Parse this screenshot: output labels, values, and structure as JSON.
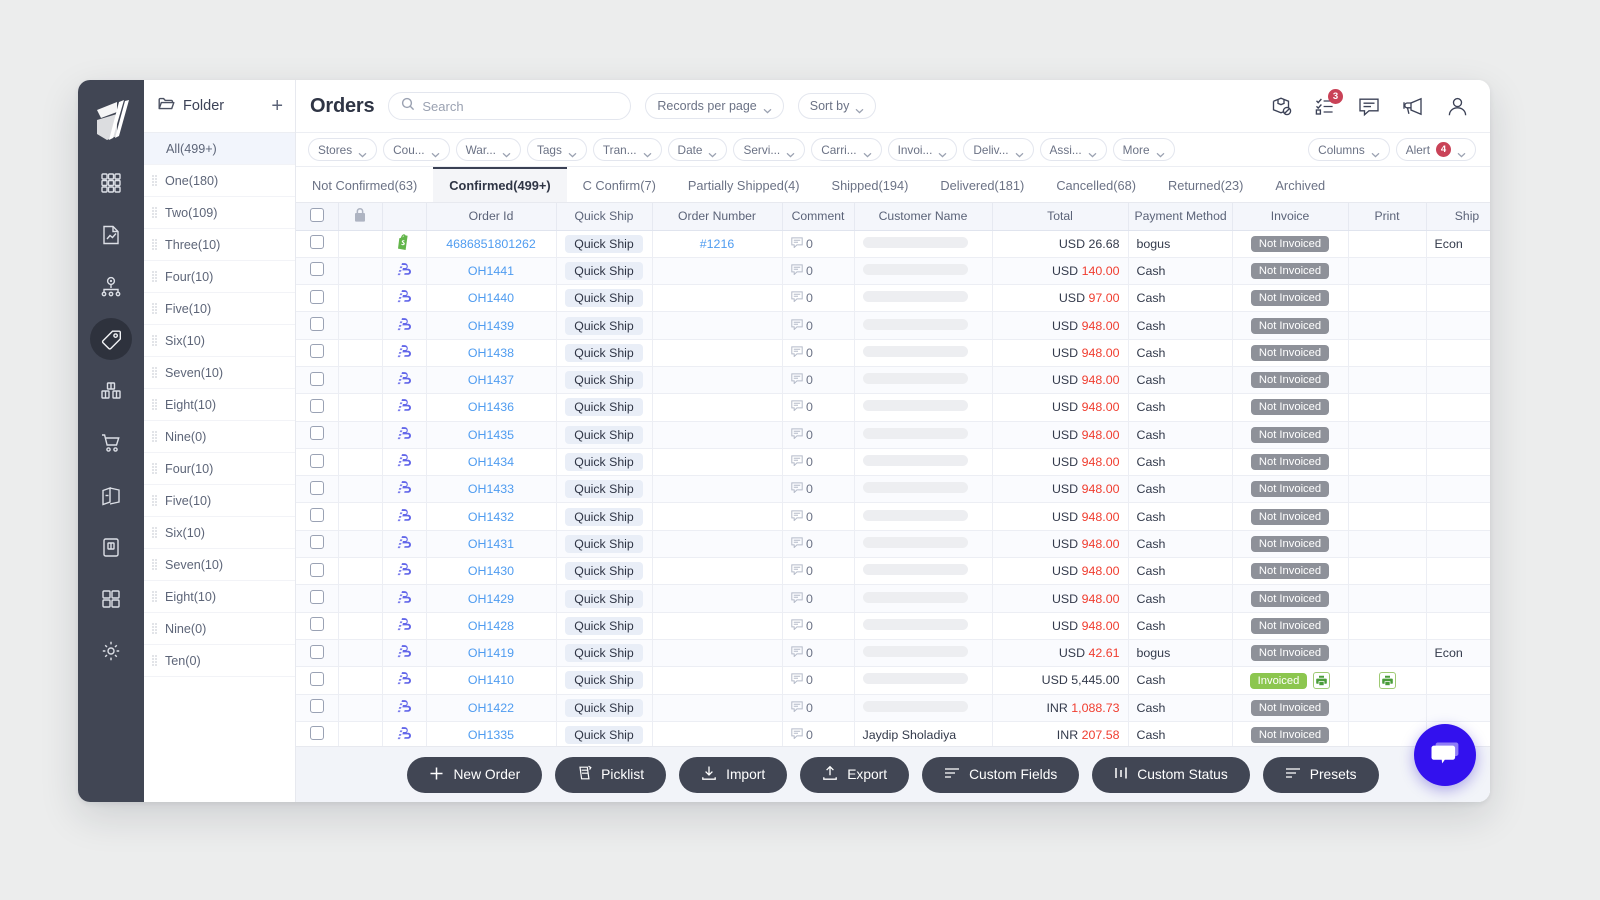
{
  "brand": {
    "accent": "#3311ee",
    "rail_bg": "#414654",
    "link": "#4f9cf0",
    "danger": "#f03d2f",
    "badge": "#c94257",
    "invoiced_green": "#8cc64f"
  },
  "header": {
    "title": "Orders",
    "search_placeholder": "Search",
    "records_per_page": "Records per page",
    "sort_by": "Sort by",
    "icons": [
      {
        "name": "package-blocked-icon",
        "badge": ""
      },
      {
        "name": "checklist-icon",
        "badge": "3"
      },
      {
        "name": "comment-icon",
        "badge": ""
      },
      {
        "name": "megaphone-icon",
        "badge": ""
      },
      {
        "name": "user-icon",
        "badge": ""
      }
    ]
  },
  "sidebar_rail": {
    "items": [
      {
        "name": "dashboard-grid-icon",
        "active": false
      },
      {
        "name": "report-document-icon",
        "active": false
      },
      {
        "name": "network-hierarchy-icon",
        "active": false
      },
      {
        "name": "tag-icon",
        "active": true
      },
      {
        "name": "inventory-boxes-icon",
        "active": false
      },
      {
        "name": "shopping-cart-icon",
        "active": false
      },
      {
        "name": "open-box-icon",
        "active": false
      },
      {
        "name": "clipboard-box-icon",
        "active": false
      },
      {
        "name": "apps-squares-icon",
        "active": false
      },
      {
        "name": "gear-icon",
        "active": false
      }
    ]
  },
  "folders": {
    "header_label": "Folder",
    "add_label": "+",
    "items": [
      {
        "label": "All(499+)",
        "selected": true
      },
      {
        "label": "One(180)",
        "selected": false
      },
      {
        "label": "Two(109)",
        "selected": false
      },
      {
        "label": "Three(10)",
        "selected": false
      },
      {
        "label": "Four(10)",
        "selected": false
      },
      {
        "label": "Five(10)",
        "selected": false
      },
      {
        "label": "Six(10)",
        "selected": false
      },
      {
        "label": "Seven(10)",
        "selected": false
      },
      {
        "label": "Eight(10)",
        "selected": false
      },
      {
        "label": "Nine(0)",
        "selected": false
      },
      {
        "label": "Four(10)",
        "selected": false
      },
      {
        "label": "Five(10)",
        "selected": false
      },
      {
        "label": "Six(10)",
        "selected": false
      },
      {
        "label": "Seven(10)",
        "selected": false
      },
      {
        "label": "Eight(10)",
        "selected": false
      },
      {
        "label": "Nine(0)",
        "selected": false
      },
      {
        "label": "Ten(0)",
        "selected": false
      }
    ]
  },
  "filters": {
    "chips": [
      "Stores",
      "Cou...",
      "War...",
      "Tags",
      "Tran...",
      "Date",
      "Servi...",
      "Carri...",
      "Invoi...",
      "Deliv...",
      "Assi...",
      "More"
    ],
    "columns_label": "Columns",
    "alert_label": "Alert",
    "alert_count": "4"
  },
  "tabs": [
    {
      "label": "Not Confirmed(63)",
      "active": false
    },
    {
      "label": "Confirmed(499+)",
      "active": true
    },
    {
      "label": "C Confirm(7)",
      "active": false
    },
    {
      "label": "Partially Shipped(4)",
      "active": false
    },
    {
      "label": "Shipped(194)",
      "active": false
    },
    {
      "label": "Delivered(181)",
      "active": false
    },
    {
      "label": "Cancelled(68)",
      "active": false
    },
    {
      "label": "Returned(23)",
      "active": false
    },
    {
      "label": "Archived",
      "active": false
    }
  ],
  "table": {
    "columns": [
      "",
      "lock-icon",
      "",
      "Order Id",
      "Quick Ship",
      "Order Number",
      "Comment",
      "Customer Name",
      "Total",
      "Payment Method",
      "Invoice",
      "Print",
      "Ship"
    ],
    "quick_ship_label": "Quick Ship",
    "not_invoiced_label": "Not Invoiced",
    "invoiced_label": "Invoiced",
    "rows": [
      {
        "channel": "shopify",
        "order_id": "4686851801262",
        "order_number": "#1216",
        "comments": "0",
        "currency": "USD",
        "amount": "26.68",
        "amount_red": false,
        "payment": "bogus",
        "invoice": "Not Invoiced",
        "invoiced": false,
        "print": false,
        "ship": "Econ"
      },
      {
        "channel": "generic",
        "order_id": "OH1441",
        "order_number": "",
        "comments": "0",
        "currency": "USD",
        "amount": "140.00",
        "amount_red": true,
        "payment": "Cash",
        "invoice": "Not Invoiced",
        "invoiced": false,
        "print": false,
        "ship": ""
      },
      {
        "channel": "generic",
        "order_id": "OH1440",
        "order_number": "",
        "comments": "0",
        "currency": "USD",
        "amount": "97.00",
        "amount_red": true,
        "payment": "Cash",
        "invoice": "Not Invoiced",
        "invoiced": false,
        "print": false,
        "ship": ""
      },
      {
        "channel": "generic",
        "order_id": "OH1439",
        "order_number": "",
        "comments": "0",
        "currency": "USD",
        "amount": "948.00",
        "amount_red": true,
        "payment": "Cash",
        "invoice": "Not Invoiced",
        "invoiced": false,
        "print": false,
        "ship": ""
      },
      {
        "channel": "generic",
        "order_id": "OH1438",
        "order_number": "",
        "comments": "0",
        "currency": "USD",
        "amount": "948.00",
        "amount_red": true,
        "payment": "Cash",
        "invoice": "Not Invoiced",
        "invoiced": false,
        "print": false,
        "ship": ""
      },
      {
        "channel": "generic",
        "order_id": "OH1437",
        "order_number": "",
        "comments": "0",
        "currency": "USD",
        "amount": "948.00",
        "amount_red": true,
        "payment": "Cash",
        "invoice": "Not Invoiced",
        "invoiced": false,
        "print": false,
        "ship": ""
      },
      {
        "channel": "generic",
        "order_id": "OH1436",
        "order_number": "",
        "comments": "0",
        "currency": "USD",
        "amount": "948.00",
        "amount_red": true,
        "payment": "Cash",
        "invoice": "Not Invoiced",
        "invoiced": false,
        "print": false,
        "ship": ""
      },
      {
        "channel": "generic",
        "order_id": "OH1435",
        "order_number": "",
        "comments": "0",
        "currency": "USD",
        "amount": "948.00",
        "amount_red": true,
        "payment": "Cash",
        "invoice": "Not Invoiced",
        "invoiced": false,
        "print": false,
        "ship": ""
      },
      {
        "channel": "generic",
        "order_id": "OH1434",
        "order_number": "",
        "comments": "0",
        "currency": "USD",
        "amount": "948.00",
        "amount_red": true,
        "payment": "Cash",
        "invoice": "Not Invoiced",
        "invoiced": false,
        "print": false,
        "ship": ""
      },
      {
        "channel": "generic",
        "order_id": "OH1433",
        "order_number": "",
        "comments": "0",
        "currency": "USD",
        "amount": "948.00",
        "amount_red": true,
        "payment": "Cash",
        "invoice": "Not Invoiced",
        "invoiced": false,
        "print": false,
        "ship": ""
      },
      {
        "channel": "generic",
        "order_id": "OH1432",
        "order_number": "",
        "comments": "0",
        "currency": "USD",
        "amount": "948.00",
        "amount_red": true,
        "payment": "Cash",
        "invoice": "Not Invoiced",
        "invoiced": false,
        "print": false,
        "ship": ""
      },
      {
        "channel": "generic",
        "order_id": "OH1431",
        "order_number": "",
        "comments": "0",
        "currency": "USD",
        "amount": "948.00",
        "amount_red": true,
        "payment": "Cash",
        "invoice": "Not Invoiced",
        "invoiced": false,
        "print": false,
        "ship": ""
      },
      {
        "channel": "generic",
        "order_id": "OH1430",
        "order_number": "",
        "comments": "0",
        "currency": "USD",
        "amount": "948.00",
        "amount_red": true,
        "payment": "Cash",
        "invoice": "Not Invoiced",
        "invoiced": false,
        "print": false,
        "ship": ""
      },
      {
        "channel": "generic",
        "order_id": "OH1429",
        "order_number": "",
        "comments": "0",
        "currency": "USD",
        "amount": "948.00",
        "amount_red": true,
        "payment": "Cash",
        "invoice": "Not Invoiced",
        "invoiced": false,
        "print": false,
        "ship": ""
      },
      {
        "channel": "generic",
        "order_id": "OH1428",
        "order_number": "",
        "comments": "0",
        "currency": "USD",
        "amount": "948.00",
        "amount_red": true,
        "payment": "Cash",
        "invoice": "Not Invoiced",
        "invoiced": false,
        "print": false,
        "ship": ""
      },
      {
        "channel": "generic",
        "order_id": "OH1419",
        "order_number": "",
        "comments": "0",
        "currency": "USD",
        "amount": "42.61",
        "amount_red": true,
        "payment": "bogus",
        "invoice": "Not Invoiced",
        "invoiced": false,
        "print": false,
        "ship": "Econ"
      },
      {
        "channel": "generic",
        "order_id": "OH1410",
        "order_number": "",
        "comments": "0",
        "currency": "USD",
        "amount": "5,445.00",
        "amount_red": false,
        "payment": "Cash",
        "invoice": "Invoiced",
        "invoiced": true,
        "print": true,
        "ship": ""
      },
      {
        "channel": "generic",
        "order_id": "OH1422",
        "order_number": "",
        "comments": "0",
        "currency": "INR",
        "amount": "1,088.73",
        "amount_red": true,
        "payment": "Cash",
        "invoice": "Not Invoiced",
        "invoiced": false,
        "print": false,
        "ship": ""
      },
      {
        "channel": "generic",
        "order_id": "OH1335",
        "order_number": "",
        "comments": "0",
        "customer": "Jaydip Sholadiya",
        "currency": "INR",
        "amount": "207.58",
        "amount_red": true,
        "payment": "Cash",
        "invoice": "Not Invoiced",
        "invoiced": false,
        "print": false,
        "ship": ""
      }
    ]
  },
  "toolbar": {
    "buttons": [
      {
        "label": "New Order",
        "icon": "plus-icon"
      },
      {
        "label": "Picklist",
        "icon": "picklist-icon"
      },
      {
        "label": "Import",
        "icon": "import-download-icon"
      },
      {
        "label": "Export",
        "icon": "export-upload-icon"
      },
      {
        "label": "Custom Fields",
        "icon": "lines-icon"
      },
      {
        "label": "Custom Status",
        "icon": "bars-icon"
      },
      {
        "label": "Presets",
        "icon": "lines-icon"
      }
    ]
  },
  "chat": {
    "name": "chat-bubble-icon"
  }
}
